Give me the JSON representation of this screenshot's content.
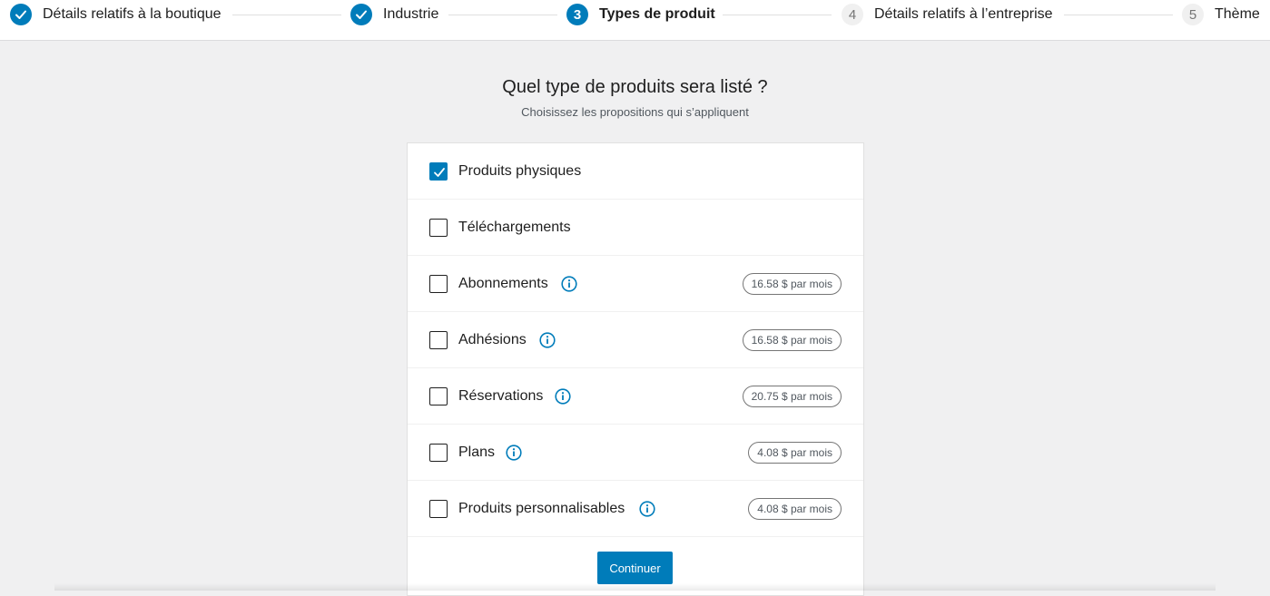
{
  "stepper": {
    "steps": [
      {
        "number": "1",
        "label": "Détails relatifs à la boutique",
        "state": "done"
      },
      {
        "number": "2",
        "label": "Industrie",
        "state": "done"
      },
      {
        "number": "3",
        "label": "Types de produit",
        "state": "current"
      },
      {
        "number": "4",
        "label": "Détails relatifs à l’entreprise",
        "state": "pending"
      },
      {
        "number": "5",
        "label": "Thème",
        "state": "pending"
      }
    ]
  },
  "main": {
    "title": "Quel type de produits sera listé ?",
    "subtitle": "Choisissez les propositions qui s’appliquent",
    "products": [
      {
        "label": "Produits physiques",
        "checked": true,
        "has_info": false,
        "price": ""
      },
      {
        "label": "Téléchargements",
        "checked": false,
        "has_info": false,
        "price": ""
      },
      {
        "label": "Abonnements",
        "checked": false,
        "has_info": true,
        "price": "16.58 $ par mois"
      },
      {
        "label": "Adhésions",
        "checked": false,
        "has_info": true,
        "price": "16.58 $ par mois"
      },
      {
        "label": "Réservations",
        "checked": false,
        "has_info": true,
        "price": "20.75 $ par mois"
      },
      {
        "label": "Plans",
        "checked": false,
        "has_info": true,
        "price": "4.08 $ par mois"
      },
      {
        "label": "Produits personnalisables",
        "checked": false,
        "has_info": true,
        "price": "4.08 $ par mois"
      }
    ],
    "continue_label": "Continuer"
  },
  "colors": {
    "accent": "#007cba",
    "background": "#f0f0f1"
  },
  "icons": {
    "done": "checkmark-icon",
    "info": "info-icon"
  }
}
